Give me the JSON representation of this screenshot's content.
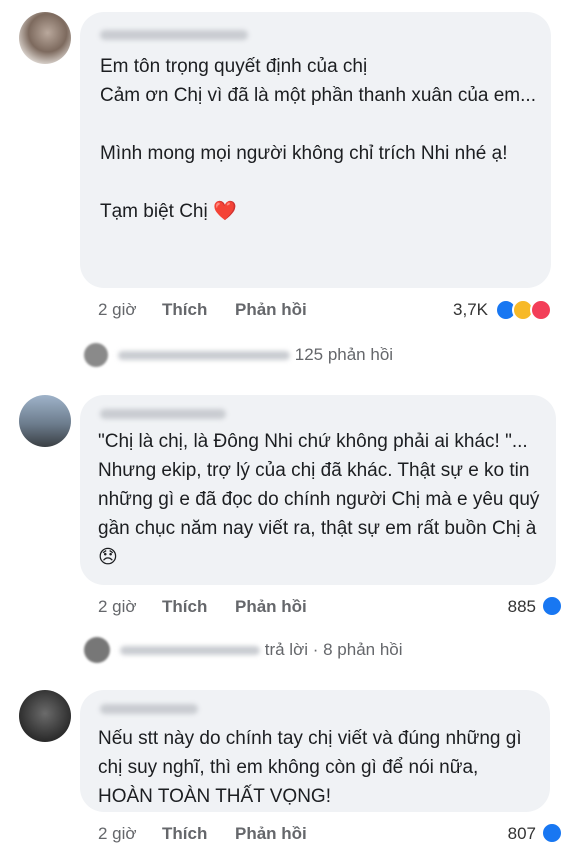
{
  "comments": [
    {
      "text": "Em tôn trọng quyết định của chị\nCảm ơn Chị vì đã là một phần thanh xuân của em...\n\nMình mong mọi người không chỉ trích Nhi nhé ạ!\n\nTạm biệt Chị",
      "emoji": "❤️",
      "time": "2 giờ",
      "like_label": "Thích",
      "reply_label": "Phản hồi",
      "reaction_count": "3,7K",
      "replies": "125 phản hồi"
    },
    {
      "text": "\"Chị là chị, là Đông Nhi chứ không phải ai khác! \"... Nhưng ekip, trợ lý của chị đã khác. Thật sự e ko tin những gì e đã đọc do chính người Chị mà e yêu quý gần chục năm nay viết ra, thật sự em rất buồn Chị à",
      "emoji": "😞",
      "time": "2 giờ",
      "like_label": "Thích",
      "reply_label": "Phản hồi",
      "reaction_count": "885",
      "replies": "trả lời · 8 phản hồi"
    },
    {
      "text": "Nếu stt này do chính tay chị viết và đúng những gì chị suy nghĩ, thì em không còn gì để nói nữa, HOÀN TOÀN THẤT VỌNG!",
      "time": "2 giờ",
      "like_label": "Thích",
      "reply_label": "Phản hồi",
      "reaction_count": "807"
    }
  ],
  "colors": {
    "bubble": "#f0f2f5",
    "like": "#1877f2",
    "sad": "#f7b928",
    "love": "#f33e58"
  }
}
